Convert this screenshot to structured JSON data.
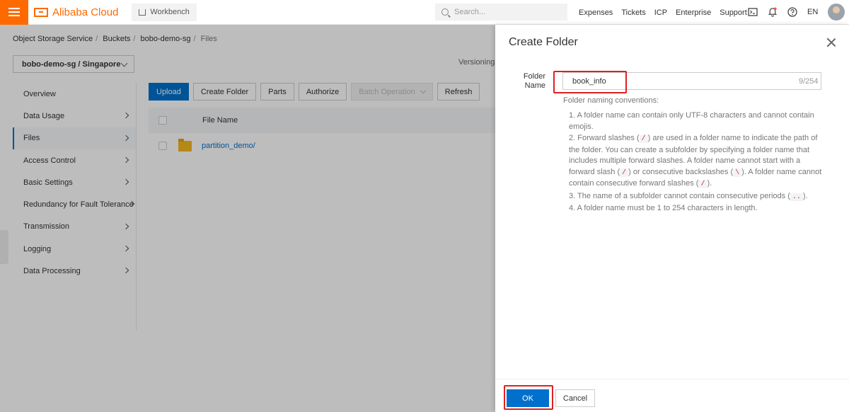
{
  "topbar": {
    "brand": "Alibaba Cloud",
    "workbench": "Workbench",
    "search_placeholder": "Search...",
    "links": [
      "Expenses",
      "Tickets",
      "ICP",
      "Enterprise",
      "Support"
    ],
    "language": "EN",
    "accent": "#ff6a00",
    "icons": [
      "menu-icon",
      "home-icon",
      "search-icon",
      "terminal-icon",
      "bell-icon",
      "help-icon",
      "avatar"
    ]
  },
  "breadcrumb": [
    "Object Storage Service",
    "Buckets",
    "bobo-demo-sg",
    "Files"
  ],
  "bucket_select": "bobo-demo-sg / Singapore",
  "versioning_label": "Versioning",
  "sidebar": {
    "items": [
      {
        "label": "Overview",
        "arrow": false
      },
      {
        "label": "Data Usage",
        "arrow": true
      },
      {
        "label": "Files",
        "arrow": true,
        "active": true
      },
      {
        "label": "Access Control",
        "arrow": true
      },
      {
        "label": "Basic Settings",
        "arrow": true
      },
      {
        "label": "Redundancy for Fault Tolerance",
        "arrow": true
      },
      {
        "label": "Transmission",
        "arrow": true
      },
      {
        "label": "Logging",
        "arrow": true
      },
      {
        "label": "Data Processing",
        "arrow": true
      }
    ]
  },
  "toolbar": {
    "upload": "Upload",
    "create_folder": "Create Folder",
    "parts": "Parts",
    "authorize": "Authorize",
    "batch_operation": "Batch Operation",
    "refresh": "Refresh"
  },
  "table": {
    "header_file_name": "File Name",
    "rows": [
      {
        "name": "partition_demo/"
      }
    ]
  },
  "drawer": {
    "title": "Create Folder",
    "field_label": "Folder Name",
    "field_value": "book_info",
    "counter": "9/254",
    "conventions_title": "Folder naming conventions:",
    "rules": {
      "r1": "1. A folder name can contain only UTF-8 characters and cannot contain emojis.",
      "r2a": "2. Forward slashes (",
      "r2b": ") are used in a folder name to indicate the path of the folder. You can create a subfolder by specifying a folder name that includes multiple forward slashes. A folder name cannot start with a forward slash (",
      "r2c": ") or consecutive backslashes (",
      "r2d": "). A folder name cannot contain consecutive forward slashes (",
      "r2e": ").",
      "slash": "/",
      "backslash": "\\",
      "r3a": "3. The name of a subfolder cannot contain consecutive periods (",
      "r3_code": "..",
      "r3b": ").",
      "r4": "4. A folder name must be 1 to 254 characters in length."
    },
    "ok": "OK",
    "cancel": "Cancel"
  },
  "highlight_color": "#e02020",
  "primary_color": "#0070cc"
}
